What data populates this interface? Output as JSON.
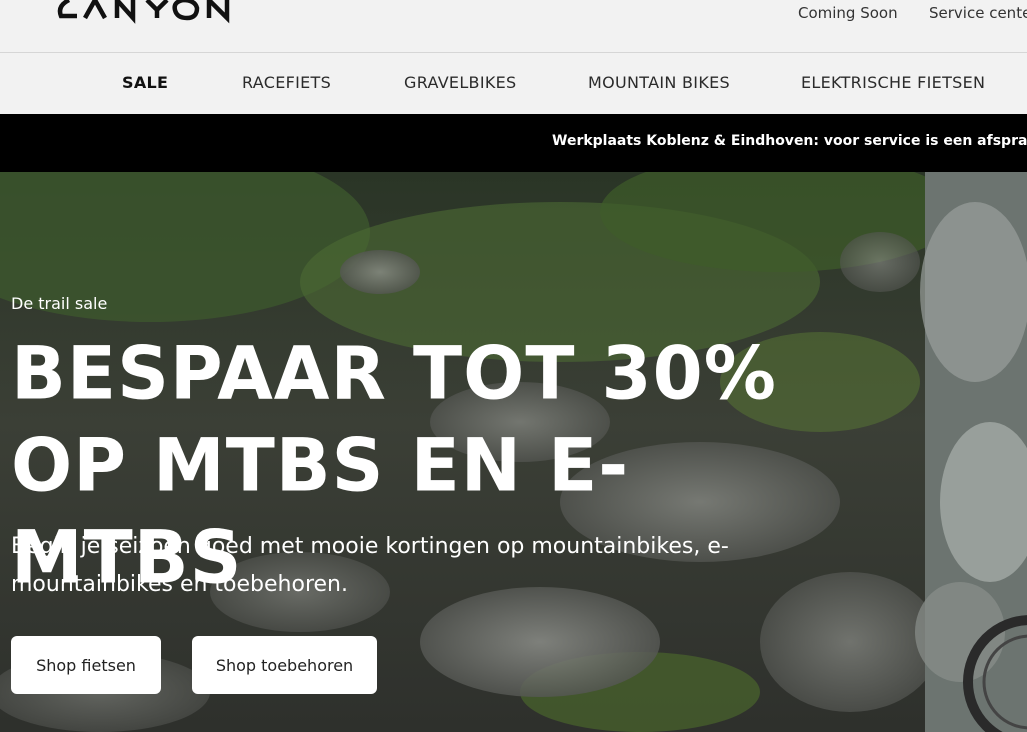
{
  "header": {
    "logo_text": "CANYON",
    "utility_links": [
      "Coming Soon",
      "Service center"
    ]
  },
  "nav": {
    "items": [
      "SALE",
      "RACEFIETS",
      "GRAVELBIKES",
      "MOUNTAIN BIKES",
      "ELEKTRISCHE FIETSEN"
    ]
  },
  "announcement": {
    "text": "Werkplaats Koblenz & Eindhoven: voor service is een afspraak vereist"
  },
  "hero": {
    "eyebrow": "De trail sale",
    "title": "BESPAAR TOT 30% OP MTBS EN E-MTBS",
    "subtitle": "Begin je seizoen goed met mooie kortingen op mountainbikes, e-mountainbikes en toebehoren.",
    "buttons": [
      "Shop fietsen",
      "Shop toebehoren"
    ]
  },
  "colors": {
    "header_bg": "#f2f2f2",
    "announcement_bg": "#000000",
    "button_bg": "#ffffff"
  }
}
